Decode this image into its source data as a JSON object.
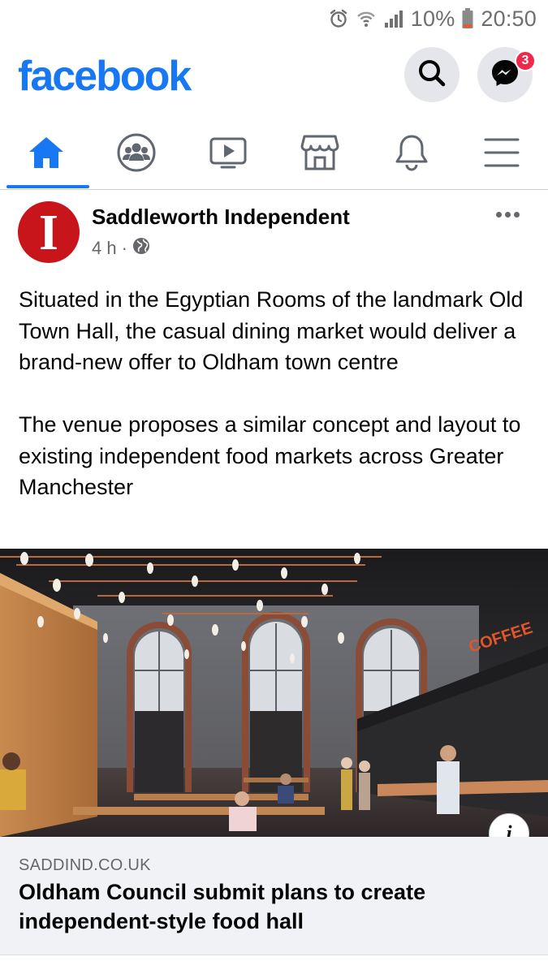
{
  "status_bar": {
    "battery": "10%",
    "time": "20:50",
    "icons": [
      "alarm-icon",
      "wifi-icon",
      "signal-icon",
      "battery-icon"
    ]
  },
  "header": {
    "logo": "facebook",
    "search_icon": "search-icon",
    "messenger_icon": "messenger-icon",
    "messenger_badge": "3",
    "colors": {
      "brand": "#1877f2",
      "badge": "#f02849"
    }
  },
  "nav": {
    "tabs": [
      {
        "name": "home",
        "icon": "home-icon",
        "active": true
      },
      {
        "name": "groups",
        "icon": "groups-icon",
        "active": false
      },
      {
        "name": "watch",
        "icon": "video-icon",
        "active": false
      },
      {
        "name": "marketplace",
        "icon": "shop-icon",
        "active": false
      },
      {
        "name": "notifications",
        "icon": "bell-icon",
        "active": false
      },
      {
        "name": "menu",
        "icon": "menu-icon",
        "active": false
      }
    ]
  },
  "post": {
    "avatar_letter": "I",
    "page_name": "Saddleworth Independent",
    "time": "4 h",
    "separator": "·",
    "audience_icon": "globe-icon",
    "more_icon": "more-icon",
    "text": [
      "Situated in the Egyptian Rooms of the landmark Old Town Hall, the casual dining market would deliver a brand-new offer to Oldham town centre",
      "The venue proposes a similar concept and layout to existing independent food markets across Greater Manchester"
    ],
    "image": {
      "sign_text": "COFFEE"
    },
    "info_label": "i",
    "link": {
      "domain": "SADDIND.CO.UK",
      "title": "Oldham Council submit plans to create independent-style food hall"
    }
  }
}
